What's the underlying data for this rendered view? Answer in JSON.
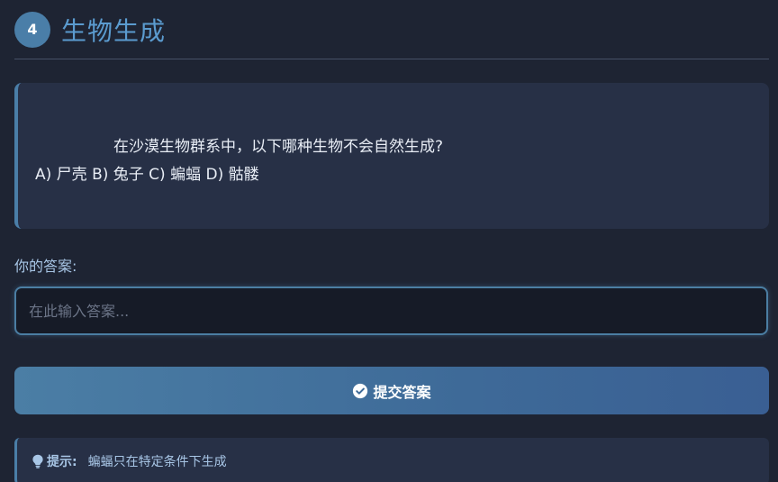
{
  "header": {
    "step_number": "4",
    "title": "生物生成"
  },
  "question": {
    "line1": "在沙漠生物群系中，以下哪种生物不会自然生成?",
    "line2": "A) 尸壳 B) 兔子 C) 蝙蝠 D) 骷髅"
  },
  "answer": {
    "label": "你的答案:",
    "placeholder": "在此输入答案...",
    "value": ""
  },
  "submit": {
    "label": "提交答案",
    "icon": "check-circle-icon"
  },
  "hint": {
    "icon": "lightbulb-icon",
    "label": "提示:",
    "text": "蝙蝠只在特定条件下生成"
  },
  "colors": {
    "background": "#1e2433",
    "accent": "#5b9bcf",
    "card": "#273046"
  }
}
